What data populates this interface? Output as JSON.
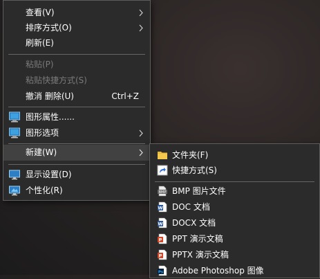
{
  "context_menu": {
    "items": [
      {
        "label": "查看(V)"
      },
      {
        "label": "排序方式(O)"
      },
      {
        "label": "刷新(E)"
      },
      {
        "label": "粘贴(P)"
      },
      {
        "label": "粘贴快捷方式(S)"
      },
      {
        "label": "撤消 删除(U)",
        "shortcut": "Ctrl+Z"
      },
      {
        "label": "图形属性......"
      },
      {
        "label": "图形选项"
      },
      {
        "label": "新建(W)"
      },
      {
        "label": "显示设置(D)"
      },
      {
        "label": "个性化(R)"
      }
    ]
  },
  "new_submenu": {
    "items": [
      {
        "label": "文件夹(F)"
      },
      {
        "label": "快捷方式(S)"
      },
      {
        "label": "BMP 图片文件",
        "icon_text": "BMP"
      },
      {
        "label": "DOC 文档",
        "icon_text": "W"
      },
      {
        "label": "DOCX 文档",
        "icon_text": "W"
      },
      {
        "label": "PPT 演示文稿",
        "icon_text": "P"
      },
      {
        "label": "PPTX 演示文稿",
        "icon_text": "P"
      },
      {
        "label": "Adobe Photoshop 图像",
        "icon_text": "Ps"
      }
    ]
  },
  "colors": {
    "menu_bg": "#2b2b2b",
    "hover_bg": "#414141",
    "disabled_text": "#7a7a7a",
    "folder": "#f2c94c",
    "word": "#2b579a",
    "powerpoint": "#d24726",
    "photoshop": "#31a8ff"
  }
}
